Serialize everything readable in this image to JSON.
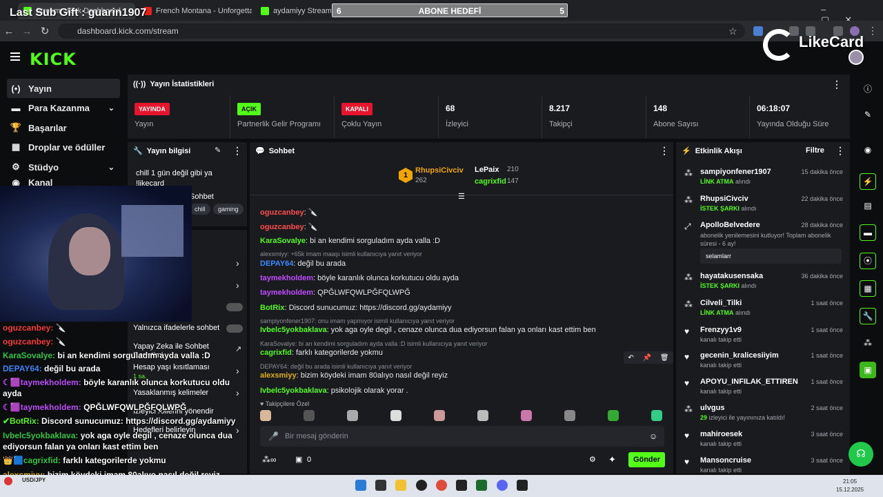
{
  "overlay": {
    "last_sub": "Last Sub Gift : guarin1907",
    "goal": {
      "left": "6",
      "title": "ABONE HEDEFİ",
      "right": "5"
    },
    "likecard": "LikeCard",
    "chat": [
      {
        "user": "oguzcanbey:",
        "text": " 🔪",
        "color": "#ff3b3b"
      },
      {
        "user": "oguzcanbey:",
        "text": " 🔪",
        "color": "#ff3b3b"
      },
      {
        "user": "KaraSovalye:",
        "text": " bi an kendimi sorguladım ayda valla :D",
        "color": "#2ecc40"
      },
      {
        "user": "DEPAY64:",
        "text": " değil bu arada",
        "color": "#3a8bff"
      },
      {
        "user": "☾🟪taymekholdem:",
        "text": " böyle karanlık olunca korkutucu oldu",
        "color": "#c24bff"
      },
      {
        "user": "",
        "text": "ayda",
        "color": "#fff"
      },
      {
        "user": "☾🟪taymekholdem:",
        "text": " QPĞLWFQWLPĞFQLWPĞ",
        "color": "#c24bff"
      },
      {
        "user": "✔BotRix:",
        "text": " Discord sunucumuz: https://discord.gg/aydamiyy",
        "color": "#53fc18"
      },
      {
        "user": "Ivbelc5yokbaklava:",
        "text": " yok aga oyle degil , cenaze olunca dua",
        "color": "#2ecc40"
      },
      {
        "user": "",
        "text": "ediyorsun falan ya onları kast ettim ben",
        "color": "#fff"
      },
      {
        "user": "👑🟦cagrixfid:",
        "text": " farklı kategorilerde yokmu",
        "color": "#2ecc40"
      },
      {
        "user": "alexsmiyy:",
        "text": " bizim köydeki imam 80alıyo nasıl değil reyiz",
        "color": "#e0b000"
      },
      {
        "user": "Ivbelc5yokbaklava:",
        "text": " psikolojik olarak yorar .",
        "color": "#2ecc40"
      }
    ]
  },
  "browser": {
    "tabs": [
      {
        "label": "Stream - Kick Dashboard",
        "color": "#53fc18"
      },
      {
        "label": "French Montana - Unforgettable",
        "color": "#e62117"
      },
      {
        "label": "aydamiyy Stream - Watch",
        "color": "#53fc18"
      }
    ],
    "url": "dashboard.kick.com/stream"
  },
  "sidebar": {
    "items": [
      {
        "label": "Yayın",
        "icon": "(•)"
      },
      {
        "label": "Para Kazanma",
        "icon": "▬"
      },
      {
        "label": "Başarılar",
        "icon": "🏆"
      },
      {
        "label": "Droplar ve ödüller",
        "icon": "▦"
      },
      {
        "label": "Stüdyo",
        "icon": "⚙"
      },
      {
        "label": "Kanal",
        "icon": "◉"
      }
    ]
  },
  "stats": {
    "title": "Yayın İstatistikleri",
    "cells": [
      {
        "value": "YAYINDA",
        "label": "Yayın",
        "badge": "red"
      },
      {
        "value": "AÇIK",
        "label": "Partnerlik Gelir Programı",
        "badge": "green"
      },
      {
        "value": "KAPALI",
        "label": "Çoklu Yayın",
        "badge": "red"
      },
      {
        "value": "68",
        "label": "İzleyici"
      },
      {
        "value": "8.217",
        "label": "Takipçi"
      },
      {
        "value": "148",
        "label": "Abone Sayısı"
      },
      {
        "value": "06:18:07",
        "label": "Yayında Olduğu Süre"
      }
    ]
  },
  "info": {
    "title": "Yayın bilgisi",
    "stream_title": "chill 1 gün değil gibi ya !likecard",
    "category": "Sohbet",
    "tags": [
      "chill",
      "gaming"
    ],
    "settings": [
      {
        "label": "Yalnızca ifadelerle sohbet"
      },
      {
        "label": "Yapay Zeka ile Sohbet Denetimi"
      },
      {
        "label": "Hesap yaşı kısıtlaması",
        "value": "1 sa."
      },
      {
        "label": "Yasaklanmış kelimeler"
      },
      {
        "label": "İzleyici rollerini yönendir"
      },
      {
        "label": "Hedefleri belirleyin"
      }
    ]
  },
  "chat": {
    "title": "Sohbet",
    "top": [
      {
        "rank": "1",
        "name": "RhupsiCivciv",
        "count": "262"
      },
      {
        "name": "LePaix",
        "count": "210"
      },
      {
        "name": "cagrixfid",
        "count": "147"
      }
    ],
    "messages": [
      {
        "user": "oguzcanbey",
        "text": ": 🔪",
        "color": "#ff4d4d",
        "reply": ""
      },
      {
        "user": "oguzcanbey",
        "text": ": 🔪",
        "color": "#ff4d4d",
        "reply": ""
      },
      {
        "user": "KaraSovalye",
        "text": ": bi an kendimi sorguladım ayda valla :D",
        "color": "#53fc18",
        "reply": ""
      },
      {
        "user": "DEPAY64",
        "text": ": değil bu arada",
        "color": "#3a8bff",
        "reply": "alexsmiyy: +65k imam maaşı isimli kullanıcıya yanıt veriyor"
      },
      {
        "user": "taymekholdem",
        "text": ": böyle karanlık olunca korkutucu oldu ayda",
        "color": "#c24bff",
        "reply": ""
      },
      {
        "user": "taymekholdem",
        "text": ": QPĞLWFQWLPĞFQLWPĞ",
        "color": "#c24bff",
        "reply": ""
      },
      {
        "user": "BotRix",
        "text": ": Discord sunucumuz: https://discord.gg/aydamiyy",
        "color": "#53fc18",
        "reply": ""
      },
      {
        "user": "Ivbelc5yokbaklava",
        "text": ": yok aga oyle degil , cenaze olunca dua ediyorsun falan ya onları kast ettim ben",
        "color": "#53fc18",
        "reply": "sampiyonfener1907: onu imam yapmıyor isimli kullanıcıya yanıt veriyor"
      },
      {
        "user": "cagrixfid",
        "text": ": farklı kategorilerde yokmu",
        "color": "#53fc18",
        "reply": "KaraSovalye: bi an kendimi sorguladım ayda valla :D isimli kullanıcıya yanıt veriyor"
      },
      {
        "user": "alexsmiyy",
        "text": ": bizim köydeki imam 80alıyo nasıl değil reyiz",
        "color": "#e0b000",
        "reply": "DEPAY64: değil bu arada isimli kullanıcıya yanıt veriyor"
      },
      {
        "user": "Ivbelc5yokbaklava",
        "text": ": psikolojik olarak yorar .",
        "color": "#53fc18",
        "reply": ""
      }
    ],
    "followers_label": "Takipçilere Özel",
    "input_placeholder": "Bir mesaj gönderin",
    "points": "0",
    "send_label": "Gönder"
  },
  "activity": {
    "title": "Etkinlik Akışı",
    "filter": "Filtre",
    "items": [
      {
        "name": "sampiyonfener1907",
        "time": "15 dakika önce",
        "action": "LİNK ATMA",
        "rest": " alındı"
      },
      {
        "name": "RhupsiCivciv",
        "time": "22 dakika önce",
        "action": "İSTEK ŞARKI",
        "rest": " alındı"
      },
      {
        "name": "ApolloBelvedere",
        "time": "28 dakika önce",
        "action": "",
        "rest": "abonelik yenilemesini kutluyor! Toplam abonelik süresi - 6 ay!",
        "msg": "selamlarr"
      },
      {
        "name": "hayatakusensaka",
        "time": "36 dakika önce",
        "action": "İSTEK ŞARKI",
        "rest": " alındı"
      },
      {
        "name": "Cilveli_Tilki",
        "time": "1 saat önce",
        "action": "LİNK ATMA",
        "rest": " alındı"
      },
      {
        "name": "Frenzyy1v9",
        "time": "1 saat önce",
        "action": "",
        "rest": "kanalı takip etti"
      },
      {
        "name": "gecenin_kralicesiiyim",
        "time": "1 saat önce",
        "action": "",
        "rest": "kanalı takip etti"
      },
      {
        "name": "APOYU_INFILAK_ETTIREN",
        "time": "1 saat önce",
        "action": "",
        "rest": "kanalı takip etti"
      },
      {
        "name": "ulvgus",
        "time": "2 saat önce",
        "action": "29",
        "rest": " izleyici ile yayınınıza katıldı!"
      },
      {
        "name": "mahiroesek",
        "time": "3 saat önce",
        "action": "",
        "rest": "kanalı takip etti"
      },
      {
        "name": "Mansoncruise",
        "time": "3 saat önce",
        "action": "",
        "rest": "kanalı takip etti"
      }
    ]
  },
  "taskbar": {
    "ticker": "USD/JPY",
    "time": "21:05",
    "date": "15.12.2025"
  }
}
